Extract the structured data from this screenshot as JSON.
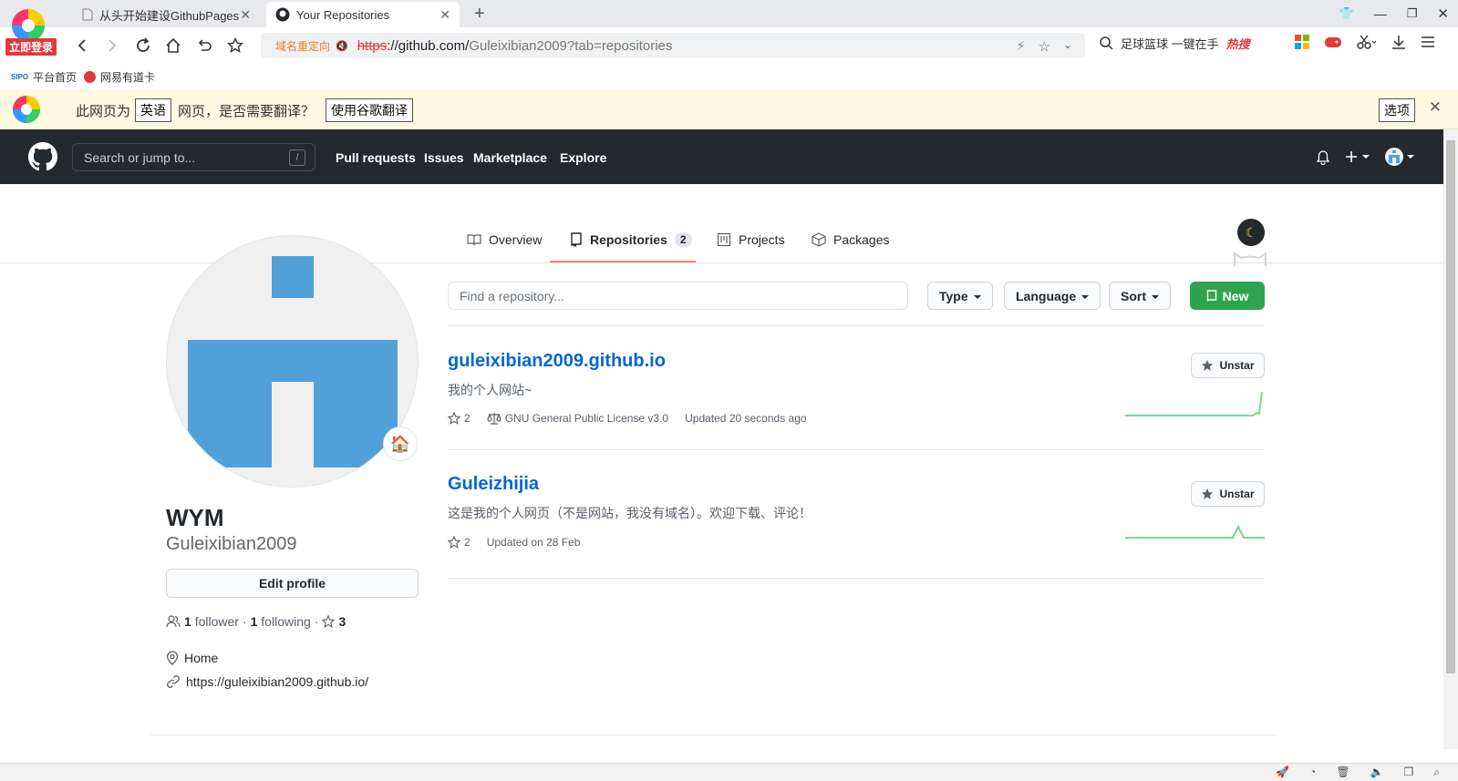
{
  "browser": {
    "tabs": [
      {
        "title": "从头开始建设GithubPages | "
      },
      {
        "title": "Your Repositories"
      }
    ],
    "login_badge": "立即登录",
    "url": {
      "redirect": "域名重定向",
      "scheme": "https",
      "host": "://github.com/",
      "path": "Guleixibian2009?tab=repositories"
    },
    "search_widget": {
      "text": "足球篮球 一键在手",
      "hot": "热搜"
    },
    "bookmarks": [
      {
        "label": "平台首页"
      },
      {
        "label": "网易有道卡"
      }
    ],
    "translate_bar": {
      "prefix": "此网页为",
      "lang": "英语",
      "mid": "网页，是否需要翻译？",
      "translate_button": "使用谷歌翻译",
      "options_button": "选项"
    }
  },
  "header": {
    "search_placeholder": "Search or jump to...",
    "search_shortcut": "/",
    "nav": [
      "Pull requests",
      "Issues",
      "Marketplace",
      "Explore"
    ]
  },
  "profile_tabs": [
    {
      "label": "Overview"
    },
    {
      "label": "Repositories",
      "count": "2"
    },
    {
      "label": "Projects"
    },
    {
      "label": "Packages"
    }
  ],
  "profile": {
    "name": "WYM",
    "login": "Guleixibian2009",
    "edit_label": "Edit profile",
    "followers": "1",
    "followers_label": "follower",
    "following": "1",
    "following_label": "following",
    "stars": "3",
    "location": "Home",
    "website": "https://guleixibian2009.github.io/",
    "status_emoji": "🏠"
  },
  "repo_filters": {
    "find_placeholder": "Find a repository...",
    "type_label": "Type",
    "language_label": "Language",
    "sort_label": "Sort",
    "new_label": "New"
  },
  "repos": [
    {
      "name": "guleixibian2009.github.io",
      "description": "我的个人网站~",
      "stars": "2",
      "license": "GNU General Public License v3.0",
      "updated": "Updated 20 seconds ago",
      "star_button": "Unstar"
    },
    {
      "name": "Guleizhijia",
      "description": "这是我的个人网页（不是网站，我没有域名）。欢迎下载、评论！",
      "stars": "2",
      "updated": "Updated on 28 Feb",
      "star_button": "Unstar"
    }
  ],
  "colors": {
    "header_bg": "#24292e",
    "link": "#0366d6",
    "new_button": "#2ea44f",
    "tab_underline": "#f9826c",
    "sparkline": "#7bd88f",
    "avatar_blue": "#52a0d8"
  }
}
